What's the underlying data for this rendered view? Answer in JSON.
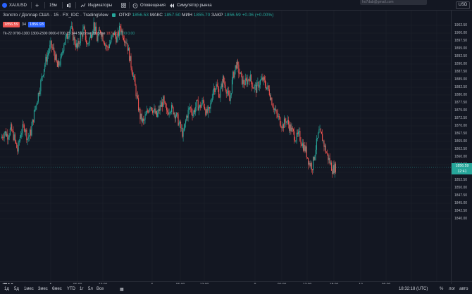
{
  "topbar": {
    "symbol": "XAUUSD",
    "add_label": "+",
    "interval": "15м",
    "indicators_label": "Индикаторы",
    "alerts_label": "Оповещения",
    "replay_label": "Симулятор рынка",
    "email": "ho7dab@gmail.com",
    "currency_button": "USD"
  },
  "legend": {
    "title": "Золото / Доллар США · 15 · FX_IDC · TradingView",
    "open_label": "ОТКР",
    "open": "1856.53",
    "high_label": "МАКС",
    "high": "1857.50",
    "low_label": "МИН",
    "low": "1855.70",
    "close_label": "ЗАКР",
    "close": "1856.59",
    "change": "+0.06 (+0.00%)"
  },
  "quote": {
    "bid": "1856.59",
    "spread": "34",
    "ask": "1856.93"
  },
  "study": {
    "text": "Tk-22 0700-1300 1300-2300 0000-0700 15 144 56 close 28 close",
    "red_val": "1871.22",
    "green_vals": "0.00  0.00"
  },
  "price_axis": {
    "ticks": [
      "1902.50",
      "1900.00",
      "1897.50",
      "1895.00",
      "1892.50",
      "1890.00",
      "1887.50",
      "1885.00",
      "1882.50",
      "1880.00",
      "1877.50",
      "1875.00",
      "1872.50",
      "1870.00",
      "1867.50",
      "1865.00",
      "1862.50",
      "1860.00",
      "1857.50",
      "1855.00",
      "1852.50",
      "1850.00",
      "1847.50",
      "1845.00",
      "1842.50",
      "1840.00"
    ],
    "last_price": "1856.59",
    "countdown": "12:41",
    "usd": "USD"
  },
  "time_axis": {
    "labels": [
      ":00",
      "5",
      "06:00",
      "12:00",
      "6",
      "06:00",
      "12:00",
      "9",
      "06:00",
      "12:00",
      "18:00",
      "10",
      "06:00"
    ]
  },
  "bottombar": {
    "ranges": [
      "1д",
      "5д",
      "1мес",
      "3мес",
      "6мес",
      "YTD",
      "1г",
      "5л",
      "Все"
    ],
    "clock": "18:32:18 (UTC)",
    "percent": "%",
    "log": "лог",
    "auto": "авто"
  },
  "colors": {
    "up": "#26a69a",
    "down": "#ef5350",
    "background": "#131722"
  },
  "chart_data": {
    "type": "candlestick",
    "symbol": "XAUUSD",
    "interval": "15",
    "ylim": [
      1838,
      1905
    ],
    "close_path": [
      1866,
      1868,
      1867,
      1869,
      1866,
      1862,
      1868,
      1870,
      1866,
      1868,
      1874,
      1879,
      1884,
      1889,
      1893,
      1896,
      1894,
      1889,
      1891,
      1897,
      1899,
      1902,
      1898,
      1895,
      1899,
      1901,
      1896,
      1899,
      1903,
      1898,
      1901,
      1898,
      1895,
      1897,
      1900,
      1898,
      1902,
      1899,
      1897,
      1891,
      1886,
      1879,
      1873,
      1871,
      1874,
      1877,
      1875,
      1873,
      1876,
      1878,
      1874,
      1876,
      1875,
      1873,
      1870,
      1867,
      1873,
      1876,
      1874,
      1877,
      1876,
      1878,
      1874,
      1875,
      1882,
      1883,
      1880,
      1885,
      1882,
      1878,
      1886,
      1890,
      1887,
      1884,
      1884,
      1886,
      1883,
      1882,
      1884,
      1885,
      1883,
      1881,
      1877,
      1874,
      1872,
      1870,
      1872,
      1870,
      1868,
      1866,
      1867,
      1864,
      1862,
      1858,
      1857,
      1863,
      1868,
      1866,
      1862,
      1859,
      1856,
      1856.59
    ],
    "grid": true
  }
}
